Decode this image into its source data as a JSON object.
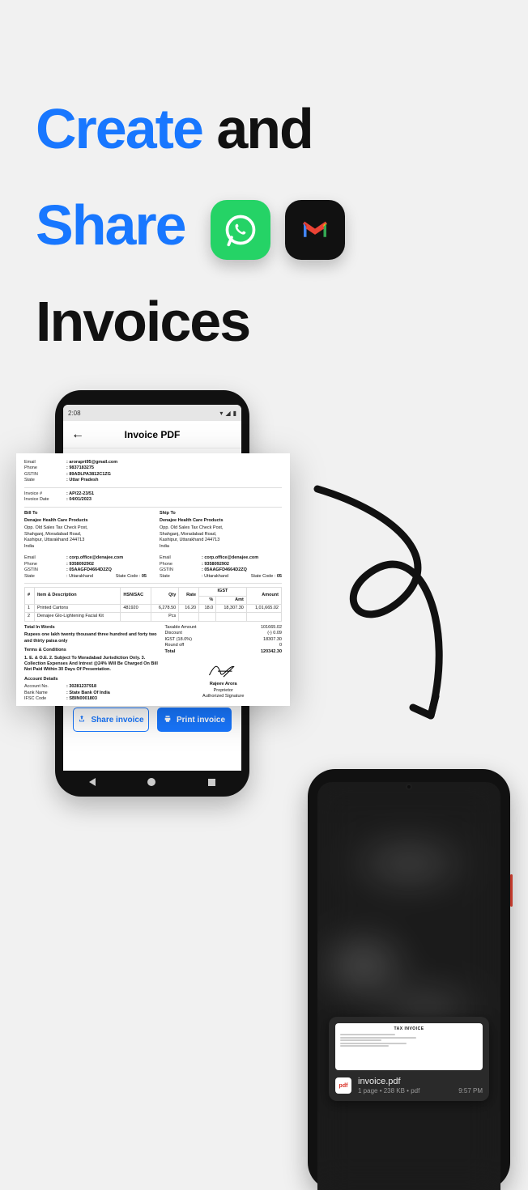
{
  "headline": {
    "word_create": "Create",
    "word_and": "and",
    "word_share": "Share",
    "word_invoices": "Invoices"
  },
  "share_icons": {
    "whatsapp": "whatsapp-icon",
    "gmail": "gmail-icon"
  },
  "phone1": {
    "status_time": "2:08",
    "appbar_title": "Invoice PDF",
    "share_btn": "Share invoice",
    "print_btn": "Print invoice"
  },
  "invoice": {
    "seller": {
      "email_lbl": "Email",
      "email": "aroraprt95@gmail.com",
      "phone_lbl": "Phone",
      "phone": "9837183275",
      "gstin_lbl": "GSTIN",
      "gstin": "89ADLPA3812C1ZG",
      "state_lbl": "State",
      "state": "Uttar Pradesh"
    },
    "meta": {
      "invno_lbl": "Invoice #",
      "invno": "AP/22-23/51",
      "invdate_lbl": "Invoice Date",
      "invdate": "04/01/2023"
    },
    "billto_h": "Bill To",
    "shipto_h": "Ship To",
    "party": {
      "name": "Denajee Health Care Products",
      "addr1": "Opp. Old Sales Tax Check Post,",
      "addr2": "Shahganj, Moradabad Road,",
      "addr3": "Kashipur, Uttarakhand 244713",
      "addr4": "India",
      "email_lbl": "Email",
      "email": "corp.office@denajee.com",
      "phone_lbl": "Phone",
      "phone": "9358092902",
      "gstin_lbl": "GSTIN",
      "gstin": "05AAGFD4664D2ZQ",
      "state_lbl": "State",
      "state": "Uttarakhand",
      "statecode_lbl": "State Code :",
      "statecode": "05"
    },
    "table": {
      "headers": [
        "#",
        "Item & Description",
        "HSN/SAC",
        "Qty",
        "Rate",
        "%",
        "Amt",
        "Amount"
      ],
      "igst_h": "IGST",
      "rows": [
        {
          "n": "1",
          "desc": "Printed Cartons",
          "hsn": "481920",
          "qty": "6,278.50",
          "rate": "16.20",
          "pct": "18.0",
          "amt": "18,307.30",
          "amount": "1,01,665.02"
        },
        {
          "n": "2",
          "desc": "Denajee Glo-Lightening Facial Kit",
          "hsn": "",
          "qty": "Pcs",
          "rate": "",
          "pct": "",
          "amt": "",
          "amount": ""
        }
      ]
    },
    "words_lbl": "Total In Words",
    "words": "Rupees one lakh twenty thousand three hundred and forty two and thirty paisa only",
    "terms_lbl": "Terms & Conditions",
    "terms": "1. E. & O.E. 2. Subject To Moradabad Jurisdiction Only. 3. Collection Expenses And Intrest @24% Will Be Charged On Bill Not Paid Within 30 Days Of Presentation.",
    "bank_lbl": "Account Details",
    "bank": {
      "acc_lbl": "Account No.",
      "acc": "30281237918",
      "name_lbl": "Bank Name",
      "name": "State Bank Of India",
      "ifsc_lbl": "IFSC Code",
      "ifsc": "SBIN0001803"
    },
    "totals": {
      "taxable_lbl": "Taxable Amount",
      "taxable": "101665.02",
      "disc_lbl": "Discount",
      "disc": "(-) 0.09",
      "igst_lbl": "IGST (18.0%)",
      "igst": "18307.30",
      "round_lbl": "Round off",
      "round": "0",
      "total_lbl": "Total",
      "total": "120342.30"
    },
    "sign_name": "Rajeev Arora",
    "sign_role1": "Proprietor",
    "sign_role2": "Authorized Signature"
  },
  "phone2": {
    "preview_title": "TAX INVOICE",
    "pdf_badge": "pdf",
    "filename": "invoice.pdf",
    "fileinfo": "1 page • 238 KB • pdf",
    "time": "9:57 PM"
  }
}
